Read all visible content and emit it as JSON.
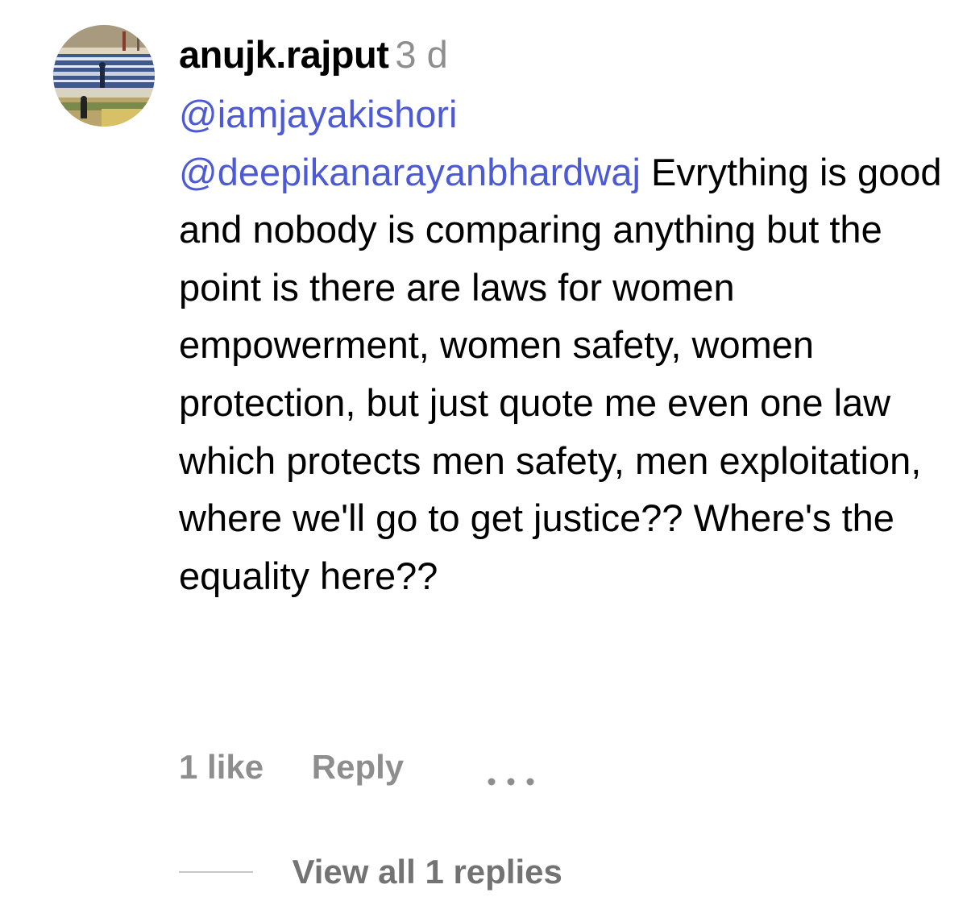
{
  "comment": {
    "username": "anujk.rajput",
    "time_ago": "3 d",
    "mentions": [
      "@iamjayakishori",
      "@deepikanarayanbhardwaj"
    ],
    "text": "Evrything is good and nobody is comparing anything but the point is there are laws for women empowerment, women safety, women protection, but just quote me even one law which protects men safety, men exploitation, where we'll go to get justice?? Where's the equality here??",
    "likes_label": "1 like",
    "reply_label": "Reply",
    "more_icon": "ellipsis-icon",
    "view_replies_label": "View all 1 replies",
    "avatar_icon": "profile-photo"
  },
  "colors": {
    "mention": "#4d5ad6",
    "muted": "#8e8e8e",
    "text": "#000000",
    "background": "#ffffff"
  }
}
